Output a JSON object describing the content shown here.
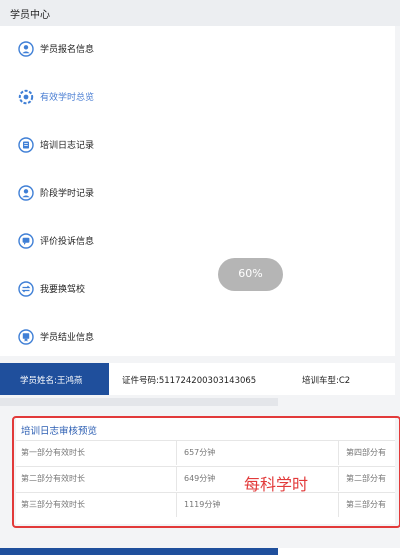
{
  "header": {
    "title": "学员中心"
  },
  "menu": {
    "items": [
      {
        "label": "学员报名信息",
        "icon": "user-icon",
        "active": false
      },
      {
        "label": "有效学时总览",
        "icon": "settings-icon",
        "active": true
      },
      {
        "label": "培训日志记录",
        "icon": "log-icon",
        "active": false
      },
      {
        "label": "阶段学时记录",
        "icon": "user-icon",
        "active": false
      },
      {
        "label": "评价投诉信息",
        "icon": "feedback-icon",
        "active": false
      },
      {
        "label": "我要换驾校",
        "icon": "switch-icon",
        "active": false
      },
      {
        "label": "学员结业信息",
        "icon": "certificate-icon",
        "active": false
      }
    ]
  },
  "progress": {
    "text": "60%",
    "value": 0.6
  },
  "student": {
    "name": "学员姓名:王鸿燕",
    "id_number": "证件号码:511724200303143065",
    "car_type": "培训车型:C2"
  },
  "preview": {
    "title": "培训日志审核预览",
    "rows": [
      {
        "label": "第一部分有效时长",
        "value": "657分钟",
        "next": "第四部分有"
      },
      {
        "label": "第二部分有效时长",
        "value": "649分钟",
        "next": "第二部分有"
      },
      {
        "label": "第三部分有效时长",
        "value": "1119分钟",
        "next": "第三部分有"
      }
    ]
  },
  "annotation": {
    "text": "每科学时"
  },
  "colors": {
    "accent": "#1f4f9c",
    "link": "#2d5fb3",
    "highlight": "#e23a3a",
    "icon": "#3f7fd6"
  }
}
